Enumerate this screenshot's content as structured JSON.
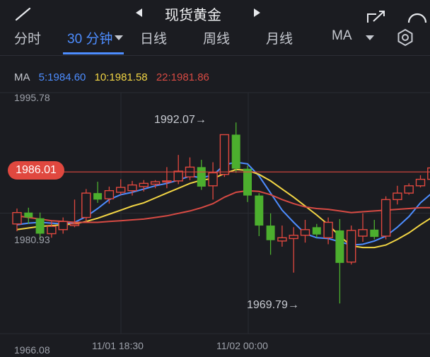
{
  "header": {
    "title": "现货黄金",
    "prev_icon": "triangle-left-icon",
    "next_icon": "triangle-right-icon"
  },
  "tabs": [
    {
      "label": "分时"
    },
    {
      "label": "30 分钟"
    },
    {
      "label": "日线"
    },
    {
      "label": "周线"
    },
    {
      "label": "月线"
    },
    {
      "label": "MA"
    }
  ],
  "ma": {
    "label": "MA",
    "ma5": "5:1984.60",
    "ma10": "10:1981.58",
    "ma22": "22:1981.86"
  },
  "chart_data": {
    "type": "candlestick",
    "y_axis": {
      "max": "1995.78",
      "mid": "1980.93",
      "min": "1966.08"
    },
    "ylim": [
      1966.08,
      1995.78
    ],
    "x_ticks": [
      "11/01 18:30",
      "11/02 00:00"
    ],
    "current_price": "1986.01",
    "annotations": {
      "high": "1992.07",
      "low": "1969.79"
    },
    "candles": [
      {
        "o": 1979.6,
        "h": 1981.5,
        "l": 1978.7,
        "c": 1981.0
      },
      {
        "o": 1981.0,
        "h": 1981.6,
        "l": 1979.6,
        "c": 1980.4
      },
      {
        "o": 1980.3,
        "h": 1981.0,
        "l": 1977.6,
        "c": 1978.4
      },
      {
        "o": 1978.4,
        "h": 1979.9,
        "l": 1977.9,
        "c": 1979.3
      },
      {
        "o": 1978.9,
        "h": 1980.4,
        "l": 1978.4,
        "c": 1979.9
      },
      {
        "o": 1979.4,
        "h": 1982.6,
        "l": 1979.2,
        "c": 1979.6
      },
      {
        "o": 1980.4,
        "h": 1983.9,
        "l": 1979.8,
        "c": 1983.4
      },
      {
        "o": 1983.4,
        "h": 1984.8,
        "l": 1982.2,
        "c": 1982.6
      },
      {
        "o": 1982.7,
        "h": 1984.2,
        "l": 1982.1,
        "c": 1983.7
      },
      {
        "o": 1983.5,
        "h": 1985.1,
        "l": 1983.2,
        "c": 1984.1
      },
      {
        "o": 1983.7,
        "h": 1984.9,
        "l": 1983.1,
        "c": 1984.4
      },
      {
        "o": 1984.2,
        "h": 1985.0,
        "l": 1983.6,
        "c": 1984.6
      },
      {
        "o": 1984.5,
        "h": 1985.0,
        "l": 1984.0,
        "c": 1984.8
      },
      {
        "o": 1984.8,
        "h": 1986.6,
        "l": 1984.0,
        "c": 1984.9
      },
      {
        "o": 1984.9,
        "h": 1988.1,
        "l": 1984.5,
        "c": 1986.1
      },
      {
        "o": 1985.4,
        "h": 1987.8,
        "l": 1985.0,
        "c": 1986.6
      },
      {
        "o": 1986.6,
        "h": 1987.5,
        "l": 1983.8,
        "c": 1984.2
      },
      {
        "o": 1984.3,
        "h": 1987.2,
        "l": 1982.6,
        "c": 1985.9
      },
      {
        "o": 1985.7,
        "h": 1990.6,
        "l": 1985.4,
        "c": 1990.6
      },
      {
        "o": 1990.6,
        "h": 1992.1,
        "l": 1985.9,
        "c": 1986.4
      },
      {
        "o": 1986.4,
        "h": 1986.8,
        "l": 1982.3,
        "c": 1983.1
      },
      {
        "o": 1983.1,
        "h": 1983.4,
        "l": 1978.1,
        "c": 1979.4
      },
      {
        "o": 1979.4,
        "h": 1980.9,
        "l": 1975.8,
        "c": 1977.6
      },
      {
        "o": 1977.5,
        "h": 1979.4,
        "l": 1976.8,
        "c": 1977.9
      },
      {
        "o": 1977.8,
        "h": 1979.2,
        "l": 1973.6,
        "c": 1978.2
      },
      {
        "o": 1978.2,
        "h": 1980.1,
        "l": 1977.3,
        "c": 1978.9
      },
      {
        "o": 1979.2,
        "h": 1979.6,
        "l": 1977.9,
        "c": 1978.3
      },
      {
        "o": 1977.9,
        "h": 1980.4,
        "l": 1977.1,
        "c": 1979.8
      },
      {
        "o": 1978.8,
        "h": 1980.2,
        "l": 1969.8,
        "c": 1974.8
      },
      {
        "o": 1974.9,
        "h": 1979.4,
        "l": 1974.6,
        "c": 1978.8
      },
      {
        "o": 1978.1,
        "h": 1980.9,
        "l": 1977.4,
        "c": 1978.9
      },
      {
        "o": 1978.9,
        "h": 1980.1,
        "l": 1977.7,
        "c": 1978.0
      },
      {
        "o": 1978.1,
        "h": 1983.0,
        "l": 1977.7,
        "c": 1982.6
      },
      {
        "o": 1982.6,
        "h": 1984.3,
        "l": 1982.0,
        "c": 1983.4
      },
      {
        "o": 1983.4,
        "h": 1984.6,
        "l": 1983.2,
        "c": 1984.3
      },
      {
        "o": 1984.3,
        "h": 1985.6,
        "l": 1984.1,
        "c": 1985.1
      },
      {
        "o": 1985.1,
        "h": 1986.6,
        "l": 1984.7,
        "c": 1986.5
      },
      {
        "o": 1986.5,
        "h": 1986.9,
        "l": 1985.8,
        "c": 1986.0
      },
      {
        "o": 1985.4,
        "h": 1986.6,
        "l": 1985.2,
        "c": 1986.4
      }
    ],
    "series": [
      {
        "name": "5",
        "color": "#4d8dff",
        "values": [
          1979.5,
          1979.7,
          1979.8,
          1979.7,
          1979.6,
          1979.8,
          1980.5,
          1981.5,
          1982.6,
          1983.2,
          1983.5,
          1983.9,
          1984.3,
          1984.6,
          1985.0,
          1985.5,
          1985.3,
          1985.6,
          1986.9,
          1987.2,
          1987.0,
          1985.5,
          1983.4,
          1981.3,
          1979.8,
          1978.4,
          1977.9,
          1977.8,
          1977.4,
          1977.0,
          1977.1,
          1977.5,
          1978.1,
          1979.2,
          1980.5,
          1982.2,
          1983.4,
          1984.3,
          1984.9
        ]
      },
      {
        "name": "10",
        "color": "#f2d544",
        "values": [
          1978.9,
          1979.1,
          1979.3,
          1979.4,
          1979.5,
          1979.6,
          1979.9,
          1980.3,
          1980.8,
          1981.3,
          1981.8,
          1982.2,
          1982.8,
          1983.4,
          1984.0,
          1984.6,
          1985.0,
          1985.2,
          1985.8,
          1986.3,
          1986.2,
          1985.7,
          1984.9,
          1983.9,
          1982.9,
          1981.8,
          1980.7,
          1979.5,
          1978.1,
          1976.9,
          1976.7,
          1976.7,
          1977.0,
          1977.7,
          1978.5,
          1979.5,
          1980.4,
          1981.3,
          1982.1
        ]
      },
      {
        "name": "22",
        "color": "#d74a43",
        "values": [
          1980.6,
          1980.4,
          1980.2,
          1980.0,
          1979.9,
          1979.8,
          1979.8,
          1979.8,
          1979.9,
          1980.0,
          1980.1,
          1980.2,
          1980.4,
          1980.6,
          1980.9,
          1981.2,
          1981.6,
          1982.1,
          1982.9,
          1983.5,
          1983.7,
          1983.6,
          1983.2,
          1982.6,
          1982.1,
          1981.7,
          1981.5,
          1981.4,
          1981.2,
          1981.0,
          1981.1,
          1981.2,
          1981.3,
          1981.4,
          1981.5,
          1981.6,
          1981.6,
          1981.7,
          1981.8
        ]
      }
    ]
  },
  "colors": {
    "up": "#e0483f",
    "down": "#4caf2e",
    "accent": "#4d8dff",
    "price_line": "#e0483f"
  }
}
